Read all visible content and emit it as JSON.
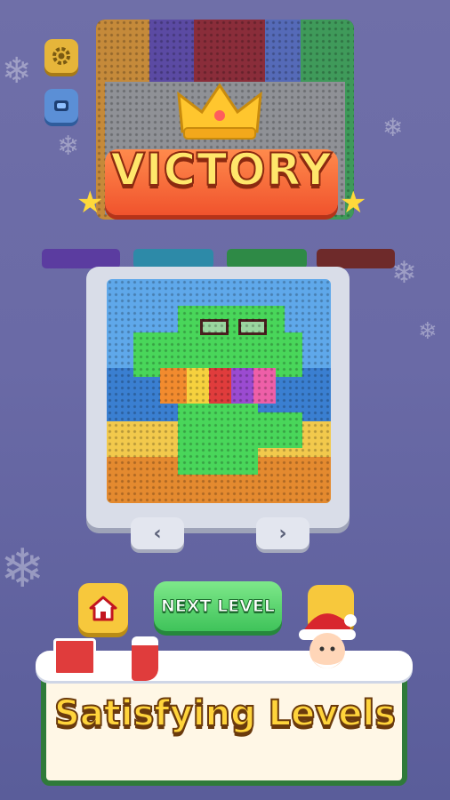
{
  "banner": {
    "title": "VICTORY"
  },
  "buttons": {
    "next_level_label": "NEXT LEVEL",
    "prev_glyph": "‹",
    "next_glyph": "›"
  },
  "promo": {
    "title": "Satisfying Levels"
  },
  "colors": {
    "background": "#6a6aa6",
    "banner": "#f0532d",
    "victory_text": "#ffe76b",
    "next_button": "#3fc35a",
    "home_button": "#f7c83c",
    "sign_border": "#2f7a3a",
    "sign_text": "#ffd43b"
  },
  "icons": {
    "settings": "gear-icon",
    "collect": "collect-icon",
    "home": "home-icon",
    "crown": "crown-icon",
    "santa": "santa-icon"
  }
}
